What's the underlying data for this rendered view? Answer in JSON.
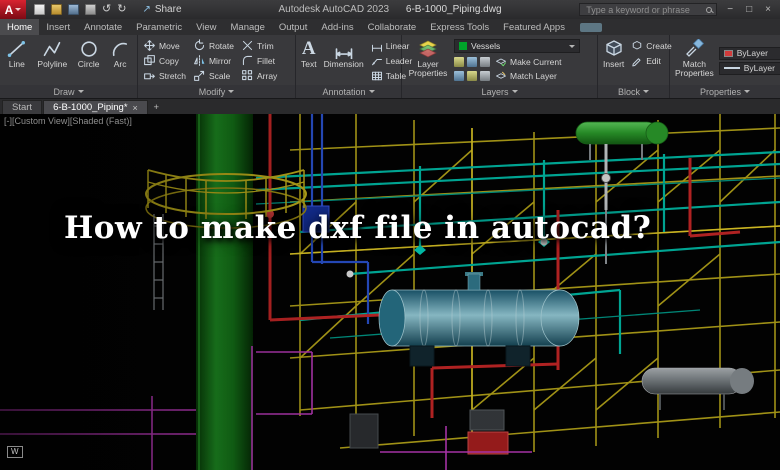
{
  "titlebar": {
    "app_glyph": "A",
    "share_label": "Share",
    "app_title": "Autodesk AutoCAD 2023",
    "doc_title": "6-B-1000_Piping.dwg",
    "search_placeholder": "Type a keyword or phrase",
    "window_min": "−",
    "window_max": "□",
    "window_close": "×"
  },
  "icons": {
    "undo": "↺",
    "redo": "↻",
    "share_arrow": "↗"
  },
  "ribbon": {
    "tabs": [
      "Home",
      "Insert",
      "Annotate",
      "Parametric",
      "View",
      "Manage",
      "Output",
      "Add-ins",
      "Collaborate",
      "Express Tools",
      "Featured Apps"
    ],
    "panels": {
      "draw": {
        "label": "Draw",
        "tools": [
          "Line",
          "Polyline",
          "Circle",
          "Arc"
        ]
      },
      "modify": {
        "label": "Modify",
        "col1": [
          "Move",
          "Copy",
          "Stretch"
        ],
        "col2": [
          "Rotate",
          "Mirror",
          "Scale"
        ],
        "col3": [
          "Trim",
          "Fillet",
          "Array"
        ]
      },
      "annotation": {
        "label": "Annotation",
        "text": "Text",
        "text_glyph": "A",
        "dimension": "Dimension",
        "rows": [
          "Linear",
          "Leader",
          "Table"
        ]
      },
      "layers": {
        "label": "Layers",
        "big": "Layer Properties",
        "dropdown_value": "Vessels",
        "make_current": "Make Current",
        "match_layer": "Match Layer"
      },
      "block": {
        "label": "Block",
        "big": "Insert",
        "create": "Create",
        "edit": "Edit"
      },
      "properties": {
        "label": "Properties",
        "big": "Match Properties",
        "row1": "ByLayer",
        "row2": "ByLayer"
      }
    }
  },
  "filetabs": {
    "start": "Start",
    "doc": "6-B-1000_Piping*",
    "close": "×",
    "new_tab": "+"
  },
  "canvas": {
    "viewport_label": "[-][Custom View][Shaded (Fast)]",
    "ucs_label": "W",
    "overlay_title": "How to make dxf file in autocad?"
  },
  "colors": {
    "brand_red": "#c01622",
    "structure_yellow": "#c9b71c",
    "pipe_cyan": "#00c4ae",
    "pipe_red": "#d02828",
    "pipe_magenta": "#c33cc3",
    "column_green": "#1f8c22",
    "vessel_teal": "#9fd9e6",
    "vessel_green": "#2da32d"
  }
}
